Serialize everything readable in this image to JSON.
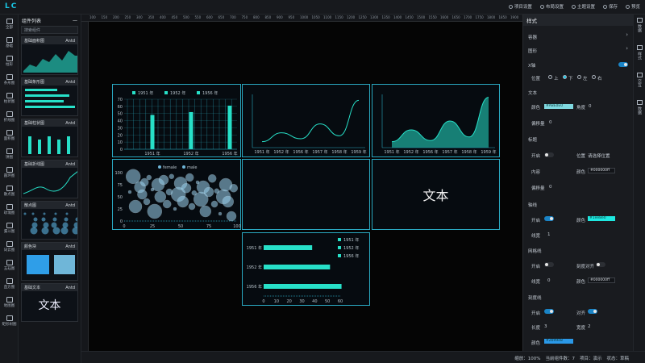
{
  "app": {
    "logo": "LC"
  },
  "topbar": {
    "buttons": [
      {
        "icon": "page-settings-icon",
        "label": "项目设置"
      },
      {
        "icon": "layout-settings-icon",
        "label": "布局设置"
      },
      {
        "icon": "theme-settings-icon",
        "label": "主题设置"
      },
      {
        "icon": "save-icon",
        "label": "保存"
      },
      {
        "icon": "preview-icon",
        "label": "预览"
      }
    ]
  },
  "leftnav": {
    "items": [
      {
        "icon": "all-icon",
        "label": "全部"
      },
      {
        "icon": "basic-icon",
        "label": "基础"
      },
      {
        "icon": "bar-icon",
        "label": "柱形"
      },
      {
        "icon": "strip-icon",
        "label": "条形图"
      },
      {
        "icon": "column-icon",
        "label": "柱状图"
      },
      {
        "icon": "line-icon",
        "label": "折线图"
      },
      {
        "icon": "area-icon",
        "label": "面积图"
      },
      {
        "icon": "pie-icon",
        "label": "饼图"
      },
      {
        "icon": "ring-icon",
        "label": "圆环图"
      },
      {
        "icon": "scatter-icon",
        "label": "散点图"
      },
      {
        "icon": "radar-icon",
        "label": "玫瑰图"
      },
      {
        "icon": "funnel-icon",
        "label": "漏斗图"
      },
      {
        "icon": "text-icon",
        "label": "词云图"
      },
      {
        "icon": "gauge-icon",
        "label": "玉珏图"
      },
      {
        "icon": "treemap-icon",
        "label": "直方图"
      },
      {
        "icon": "map-icon",
        "label": "地图图"
      },
      {
        "icon": "table-icon",
        "label": "矩形树图"
      }
    ]
  },
  "library": {
    "title": "组件列表",
    "search_placeholder": "搜索组件",
    "cards": [
      {
        "name": "基础面积图",
        "tag": "Antd"
      },
      {
        "name": "基础条形图",
        "tag": "Antd"
      },
      {
        "name": "基础柱状图",
        "tag": "Antd"
      },
      {
        "name": "基础折线图",
        "tag": "Antd"
      },
      {
        "name": "散点图",
        "tag": "Antd"
      },
      {
        "name": "颜色块",
        "tag": "Antd"
      },
      {
        "name": "基础文本",
        "tag": "Antd",
        "preview_text": "文本"
      }
    ]
  },
  "ruler": {
    "ticks": [
      "100",
      "150",
      "200",
      "250",
      "300",
      "350",
      "400",
      "450",
      "500",
      "550",
      "600",
      "650",
      "700",
      "750",
      "800",
      "850",
      "900",
      "950",
      "1000",
      "1050",
      "1100",
      "1150",
      "1200",
      "1250",
      "1300",
      "1350",
      "1400",
      "1450",
      "1500",
      "1550",
      "1600",
      "1650",
      "1700",
      "1750",
      "1800",
      "1850",
      "1900",
      "1950"
    ]
  },
  "canvas": {
    "text_widget": "文本",
    "chart_data": [
      {
        "type": "bar",
        "categories": [
          "1951 年",
          "1952 年",
          "1956 年"
        ],
        "series": [
          {
            "name": "1951 年",
            "values": [
              48
            ]
          },
          {
            "name": "1952 年",
            "values": [
              52
            ]
          },
          {
            "name": "1956 年",
            "values": [
              61
            ]
          }
        ],
        "legend": [
          "1951 年",
          "1952 年",
          "1956 年"
        ],
        "yticks": [
          "0",
          "10",
          "20",
          "30",
          "40",
          "50",
          "60",
          "70"
        ],
        "ylim": [
          0,
          70
        ],
        "legend_position": "top"
      },
      {
        "type": "line",
        "categories": [
          "1951 年",
          "1952 年",
          "1956 年",
          "1957 年",
          "1958 年",
          "1959 年"
        ],
        "values": [
          10,
          25,
          15,
          40,
          20,
          80
        ],
        "ylim": [
          0,
          90
        ]
      },
      {
        "type": "area",
        "categories": [
          "1951 年",
          "1952 年",
          "1956 年",
          "1957 年",
          "1958 年",
          "1959 年"
        ],
        "values": [
          10,
          30,
          12,
          45,
          18,
          85
        ],
        "ylim": [
          0,
          90
        ]
      },
      {
        "type": "scatter",
        "legend": [
          "female",
          "male"
        ],
        "yticks": [
          "0",
          "25",
          "50",
          "75",
          "100"
        ],
        "xticks": [
          "0",
          "25",
          "50",
          "75",
          "100"
        ],
        "points": [
          [
            5,
            60
          ],
          [
            8,
            92
          ],
          [
            10,
            30
          ],
          [
            14,
            70
          ],
          [
            16,
            55
          ],
          [
            18,
            80
          ],
          [
            20,
            40
          ],
          [
            22,
            90
          ],
          [
            25,
            65
          ],
          [
            27,
            20
          ],
          [
            30,
            75
          ],
          [
            32,
            50
          ],
          [
            35,
            85
          ],
          [
            38,
            35
          ],
          [
            40,
            60
          ],
          [
            42,
            92
          ],
          [
            45,
            25
          ],
          [
            48,
            55
          ],
          [
            50,
            78
          ],
          [
            52,
            40
          ],
          [
            55,
            68
          ],
          [
            58,
            90
          ],
          [
            60,
            30
          ],
          [
            62,
            58
          ],
          [
            65,
            80
          ],
          [
            68,
            45
          ],
          [
            70,
            70
          ],
          [
            72,
            20
          ],
          [
            75,
            60
          ],
          [
            78,
            88
          ],
          [
            80,
            35
          ],
          [
            82,
            62
          ],
          [
            85,
            15
          ],
          [
            88,
            50
          ],
          [
            90,
            75
          ],
          [
            92,
            40
          ],
          [
            95,
            10
          ],
          [
            97,
            68
          ]
        ]
      },
      {
        "type": "bar",
        "orientation": "horizontal",
        "categories": [
          "1951 年",
          "1952 年",
          "1956 年"
        ],
        "values": [
          38,
          52,
          61
        ],
        "xticks": [
          "0",
          "10",
          "20",
          "30",
          "40",
          "50",
          "60"
        ],
        "xlim": [
          0,
          60
        ],
        "legend": [
          "1951 年",
          "1952 年",
          "1956 年"
        ]
      }
    ]
  },
  "rpanel": {
    "title": "样式",
    "sections": {
      "container": "容器",
      "graph": "图形",
      "xaxis": "X轴"
    },
    "position_label": "位置",
    "position_options": [
      "上",
      "下",
      "左",
      "右"
    ],
    "text_section": "文本",
    "color_label": "颜色",
    "color_value": "#A8E0E0",
    "angle_label": "角度",
    "angle_value": "0",
    "offset_label": "偏移量",
    "offset_value": "0",
    "title_section": "标题",
    "open_label": "开启",
    "pos_label": "位置",
    "pos_value": "请选择位置",
    "content_label": "内容",
    "color2_label": "颜色",
    "color2_value": "#000000ff",
    "offset2_label": "偏移量",
    "offset2_value": "0",
    "axisline_section": "轴线",
    "open2_label": "开启",
    "color3_label": "颜色",
    "color3_value": "#1ee8e0",
    "width_label": "线宽",
    "width_value": "1",
    "grid_section": "网格线",
    "open3_label": "开启",
    "align_label": "刻度对齐",
    "width2_label": "线宽",
    "width2_value": "0",
    "color4_label": "颜色",
    "color4_value": "#000000ff",
    "tick_section": "刻度线",
    "open4_label": "开启",
    "align2_label": "对齐",
    "length_label": "长度",
    "length_value": "3",
    "width3_label": "宽度",
    "width3_value": "2",
    "color5_label": "颜色",
    "color5_value": "#2b99e8"
  },
  "rtabs": [
    {
      "icon": "data-icon",
      "label": "数据"
    },
    {
      "icon": "style-icon",
      "label": "样式"
    },
    {
      "icon": "event-icon",
      "label": "交互"
    },
    {
      "icon": "setting-icon",
      "label": "数据"
    }
  ],
  "statusbar": {
    "zoom": "缩放：100%",
    "count": "当前组件数：7",
    "project": "项目：演示",
    "state": "状态：草稿"
  },
  "colors": {
    "accent": "#19c7e6",
    "series": "#27e0c8",
    "panel_border": "#2aa9c2"
  }
}
